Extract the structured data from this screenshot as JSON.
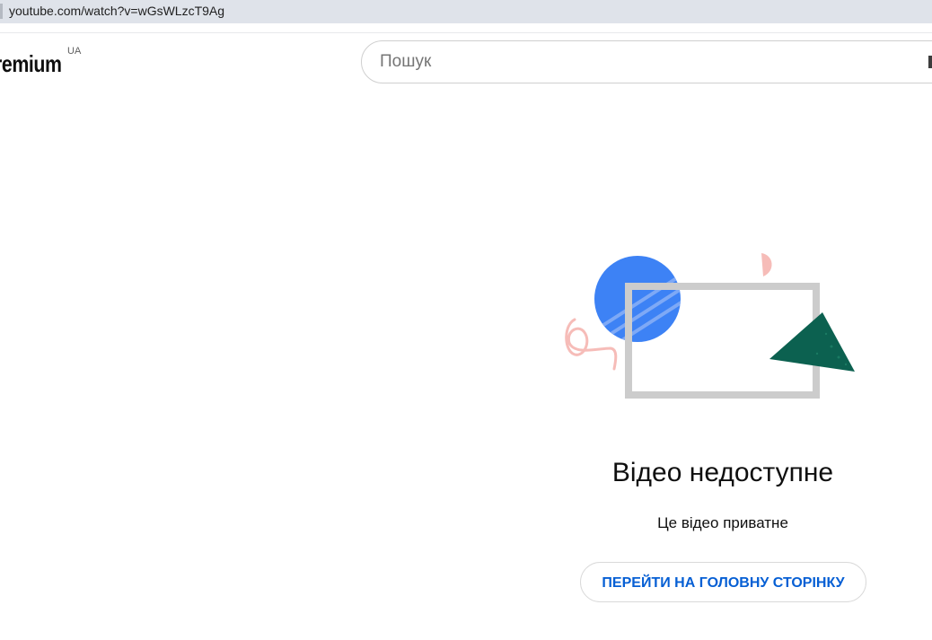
{
  "browser": {
    "url": "youtube.com/watch?v=wGsWLzcT9Ag"
  },
  "header": {
    "logo_text": "remium",
    "country_code": "UA",
    "search": {
      "placeholder": "Пошук",
      "value": ""
    }
  },
  "error": {
    "illustration": "video-unavailable-illustration",
    "title": "Відео недоступне",
    "reason": "Це відео приватне",
    "home_button_label": "ПЕРЕЙТИ НА ГОЛОВНУ СТОРІНКУ"
  },
  "colors": {
    "link_blue": "#065fd4",
    "blue_circle": "#3d82f5",
    "green_triangle": "#0c6150",
    "pink_accent": "#f6bcb8",
    "frame_grey": "#cccccc"
  }
}
